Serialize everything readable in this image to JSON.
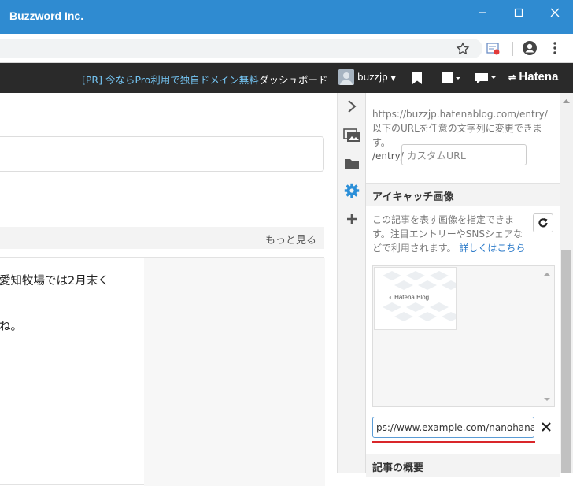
{
  "window": {
    "title": "Buzzword Inc."
  },
  "hatena_bar": {
    "promo": "[PR] 今ならPro利用で独自ドメイン無料",
    "dashboard": "ダッシュボード",
    "username": "buzzjp",
    "logo": "Hatena"
  },
  "main": {
    "more_link": "もっと見る",
    "article_lines": [
      "愛知牧場では2月末く",
      "ね。"
    ]
  },
  "panel": {
    "url_help": "https://buzzjp.hatenablog.com/entry/以下のURLを任意の文字列に変更できます。",
    "entry_prefix": "/entry/",
    "custom_url_placeholder": "カスタムURL",
    "eyecatch_title": "アイキャッチ画像",
    "eyecatch_desc": "この記事を表す画像を指定できます。注目エントリーやSNSシェアなどで利用されます。",
    "eyecatch_link": "詳しくはこちら",
    "thumb_label": "Hatena Blog",
    "image_url_value": "ps://www.example.com/nanohana.jpg",
    "summary_title": "記事の概要"
  },
  "icons": [
    "star-icon",
    "extension-icon",
    "account-icon",
    "menu-dots-icon",
    "bookmark-icon",
    "grid-icon",
    "chat-icon",
    "chevron-right-icon",
    "photo-icon",
    "folder-icon",
    "gear-icon",
    "plus-icon",
    "refresh-icon",
    "close-icon"
  ],
  "colors": {
    "titlebar": "#2f8bd1",
    "hatena_bar": "#2a2a2a",
    "promo": "#74c4f2",
    "link": "#2b7ac9",
    "gear_active": "#2b8fd8",
    "underline": "#d9262a"
  }
}
